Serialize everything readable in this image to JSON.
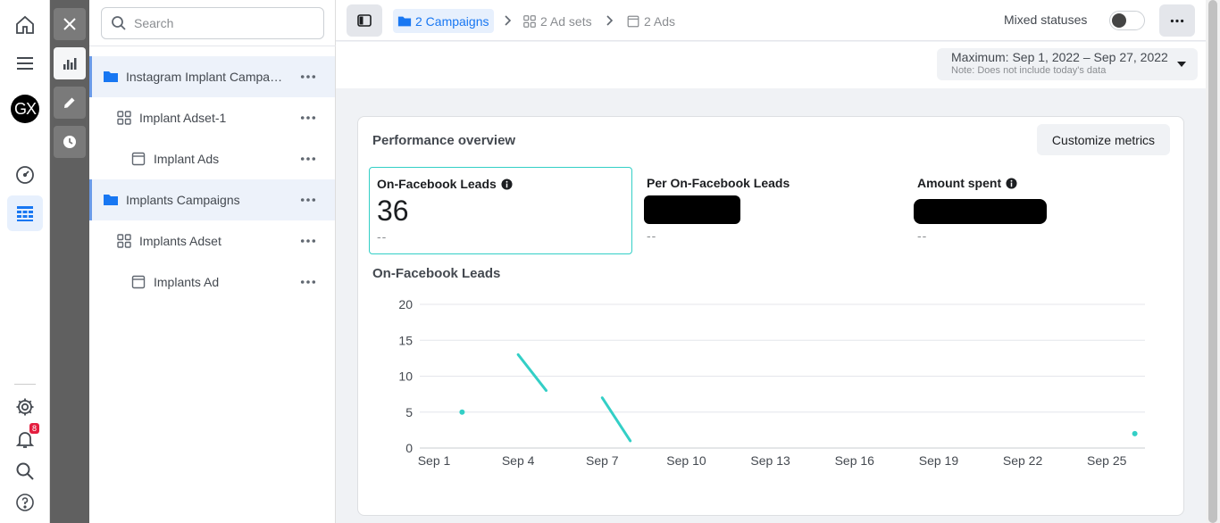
{
  "rail": {
    "avatar_text": "GX",
    "notification_count": "8"
  },
  "search": {
    "placeholder": "Search"
  },
  "tree": {
    "items": [
      {
        "label": "Instagram Implant Campaign",
        "level": "campaign",
        "selected": true
      },
      {
        "label": "Implant Adset-1",
        "level": "adset",
        "selected": false
      },
      {
        "label": "Implant Ads",
        "level": "ad",
        "selected": false
      },
      {
        "label": "Implants Campaigns",
        "level": "campaign",
        "selected": true
      },
      {
        "label": "Implants Adset",
        "level": "adset",
        "selected": false
      },
      {
        "label": "Implants Ad",
        "level": "ad",
        "selected": false
      }
    ]
  },
  "breadcrumb": {
    "campaigns": "2 Campaigns",
    "adsets": "2 Ad sets",
    "ads": "2 Ads"
  },
  "status_filter": {
    "label": "Mixed statuses",
    "on": false
  },
  "date_range": {
    "label": "Maximum: Sep 1, 2022 – Sep 27, 2022",
    "note": "Note: Does not include today's data"
  },
  "overview": {
    "title": "Performance overview",
    "customize_label": "Customize metrics",
    "metrics": [
      {
        "label": "On-Facebook Leads",
        "value": "36",
        "delta": "--",
        "has_info": true
      },
      {
        "label": "Per On-Facebook Leads",
        "value": "",
        "delta": "--",
        "has_info": false
      },
      {
        "label": "Amount spent",
        "value": "",
        "delta": "--",
        "has_info": true
      }
    ]
  },
  "colors": {
    "accent": "#1877f2",
    "series": "#33cfc6"
  },
  "chart_data": {
    "type": "line",
    "title": "On-Facebook Leads",
    "xlabel": "",
    "ylabel": "",
    "x_ticks": [
      "Sep 1",
      "Sep 4",
      "Sep 7",
      "Sep 10",
      "Sep 13",
      "Sep 16",
      "Sep 19",
      "Sep 22",
      "Sep 25"
    ],
    "y_ticks": [
      0,
      5,
      10,
      15,
      20
    ],
    "ylim": [
      0,
      20
    ],
    "xlim": [
      1,
      27
    ],
    "grid": true,
    "series": [
      {
        "points": [
          {
            "x": 2,
            "y": 5
          },
          {
            "x": 4,
            "y": 13
          },
          {
            "x": 5,
            "y": 8
          },
          {
            "x": 7,
            "y": 7
          },
          {
            "x": 8,
            "y": 1
          },
          {
            "x": 26,
            "y": 2
          }
        ],
        "segments": [
          [
            1,
            2
          ],
          [
            3,
            4
          ]
        ],
        "isolated": [
          0,
          5
        ]
      }
    ]
  }
}
